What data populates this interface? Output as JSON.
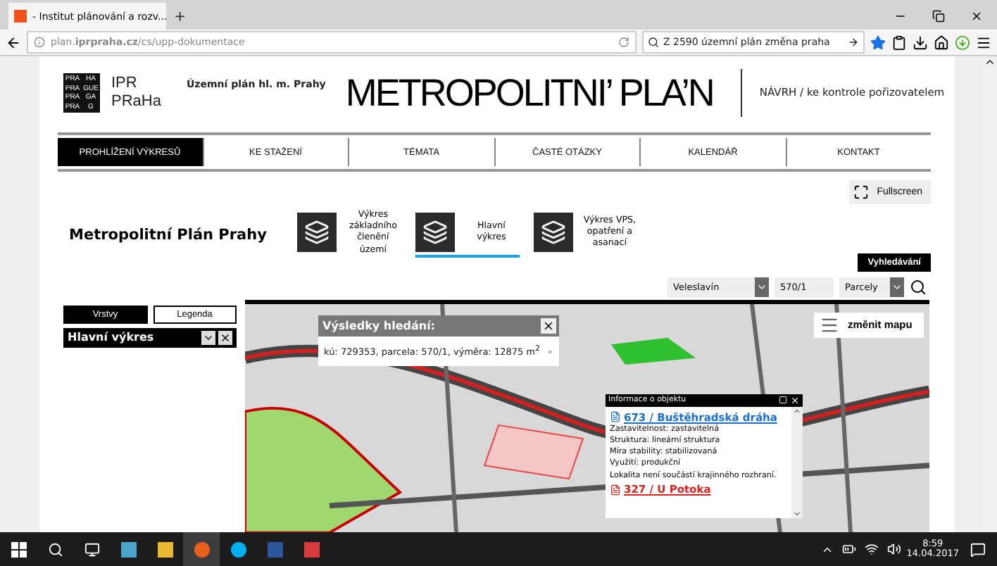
{
  "browser": {
    "tab": {
      "title": "- Institut plánování a rozv..."
    },
    "new_tab": "+",
    "url": "plan.**iprpraha.cz**/cs/upp-dokumentace",
    "search": {
      "value": "Z 2590 územní plán změna praha"
    }
  },
  "header": {
    "logo_cells": [
      "PRA",
      "HA",
      "PRA",
      "GUE",
      "PRA",
      "GA",
      "PRA",
      "G"
    ],
    "logo_text": [
      "IPR",
      "PRaHa"
    ],
    "subtitle": "Územní plán hl. m. Prahy",
    "title": "METROPOLITNI’ PLA’N",
    "tagline": "NÁVRH / ke kontrole pořizovatelem"
  },
  "nav": [
    {
      "label": "PROHLÍŽENÍ VÝKRESŮ",
      "selected": true
    },
    {
      "label": "KE STAŽENÍ",
      "selected": false
    },
    {
      "label": "TÉMATA",
      "selected": false
    },
    {
      "label": "ČASTÉ OTÁZKY",
      "selected": false
    },
    {
      "label": "KALENDÁŘ",
      "selected": false
    },
    {
      "label": "KONTAKT",
      "selected": false
    }
  ],
  "toolbar": {
    "fullscreen": "Fullscreen",
    "page_title": "Metropolitní Plán Prahy",
    "drawings": [
      {
        "label": "Výkres základního členění území",
        "selected": false
      },
      {
        "label": "Hlavní výkres",
        "selected": true
      },
      {
        "label": "Výkres VPS, opatření a asanací",
        "selected": false
      }
    ],
    "search_button": "Vyhledávání"
  },
  "search": {
    "area": "Veleslavín",
    "parcel": "570/1",
    "type": "Parcely"
  },
  "layers": {
    "tabs": [
      {
        "label": "Vrstvy",
        "selected": true
      },
      {
        "label": "Legenda",
        "selected": false
      }
    ],
    "panel_title": "Hlavní výkres"
  },
  "map": {
    "change_map": "změnit mapu",
    "results": {
      "title": "Výsledky hledání:",
      "text": "kú: 729353, parcela: 570/1, výměra: 12875 m$^{2}$"
    },
    "info": {
      "title": "Informace o objektu",
      "items": [
        {
          "kind": "link",
          "text": "673 / Buštěhradská dráha",
          "color": "#1a6fd6"
        },
        {
          "kind": "text",
          "text": "Zastavitelnost: zastavitelná"
        },
        {
          "kind": "text",
          "text": "Struktura: lineární struktura"
        },
        {
          "kind": "text",
          "text": "Míra stability: stabilizovaná"
        },
        {
          "kind": "text",
          "text": "Využití: produkční"
        },
        {
          "kind": "text",
          "text": "Lokalita není součástí krajinného rozhraní."
        },
        {
          "kind": "link",
          "text": "327 / U Potoka",
          "color": "#e0201c"
        }
      ]
    }
  },
  "taskbar": {
    "time": "8:59",
    "date": "14.04.2017"
  }
}
